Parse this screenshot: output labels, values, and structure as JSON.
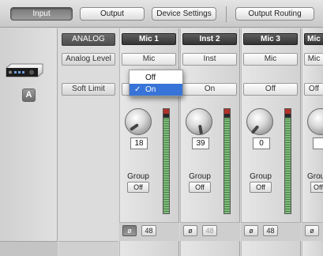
{
  "toolbar": {
    "tabs": [
      {
        "label": "Input",
        "active": true
      },
      {
        "label": "Output",
        "active": false
      },
      {
        "label": "Device Settings",
        "active": false
      },
      {
        "label": "Output Routing",
        "active": false
      }
    ]
  },
  "left_pane": {
    "badge_label": "A"
  },
  "row_labels": {
    "analog": "ANALOG",
    "analog_level": "Analog Level",
    "soft_limit": "Soft Limit"
  },
  "channels": [
    {
      "name": "Mic 1",
      "level": "Mic",
      "soft_limit": "On",
      "gain": "18",
      "group_label": "Group",
      "group_button": "Off",
      "phase": "ø",
      "phantom": "48",
      "phase_active": true,
      "phantom_enabled": true,
      "meter_level": 0.92
    },
    {
      "name": "Inst 2",
      "level": "Inst",
      "soft_limit": "On",
      "gain": "39",
      "group_label": "Group",
      "group_button": "Off",
      "phase": "ø",
      "phantom": "48",
      "phase_active": false,
      "phantom_enabled": false,
      "meter_level": 0.92
    },
    {
      "name": "Mic 3",
      "level": "Mic",
      "soft_limit": "Off",
      "gain": "0",
      "group_label": "Group",
      "group_button": "Off",
      "phase": "ø",
      "phantom": "48",
      "phase_active": false,
      "phantom_enabled": true,
      "meter_level": 0.92
    },
    {
      "name": "Mic",
      "level": "Mic",
      "soft_limit": "Off",
      "gain": "",
      "group_label": "Group",
      "group_button": "Off",
      "phase": "ø",
      "phantom": "",
      "phase_active": false,
      "phantom_enabled": true,
      "meter_level": 0.92
    }
  ],
  "popup": {
    "options": [
      {
        "label": "Off",
        "checked": false,
        "highlighted": false
      },
      {
        "label": "On",
        "checked": true,
        "highlighted": true
      }
    ],
    "check_mark": "✓"
  },
  "colors": {
    "highlight": "#3874d8",
    "meter_green": "#7fbc7a",
    "meter_clip": "#b0332a"
  }
}
